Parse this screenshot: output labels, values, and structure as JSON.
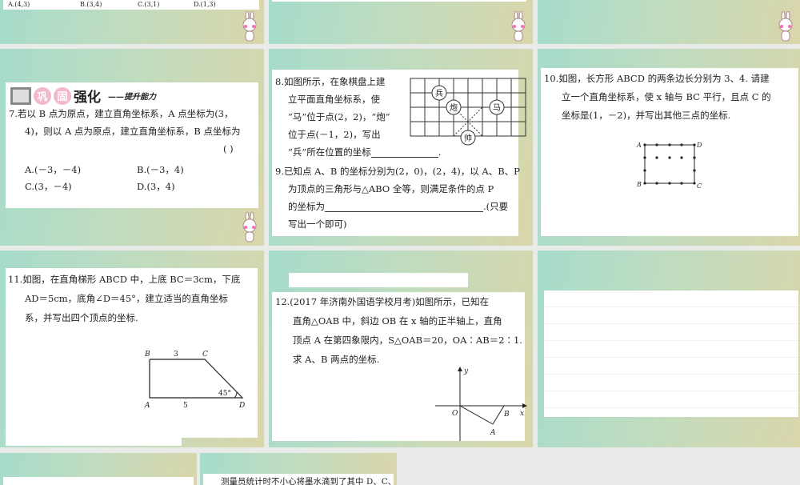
{
  "slide1_top": {
    "options": [
      "A.(4,3)",
      "B.(3,4)",
      "C.(3,1)",
      "D.(1,3)"
    ]
  },
  "q7": {
    "header_badges": [
      "巩",
      "固"
    ],
    "header_title": "强化",
    "header_sub": "——提升能力",
    "line1": "7.若以 B 点为原点，建立直角坐标系，A 点坐标为(3，",
    "line2": "4)，则以 A 点为原点，建立直角坐标系，B 点坐标为",
    "paren": "(      )",
    "options": [
      "A.(－3，－4)",
      "B.(－3，4)",
      "C.(3，－4)",
      "D.(3，4)"
    ]
  },
  "q8": {
    "lines": [
      "8.如图所示，在象棋盘上建",
      "立平面直角坐标系，使",
      "“马”位于点(2，2)，“炮”",
      "位于点(－1，2)，写出",
      "“兵”所在位置的坐标"
    ],
    "end": ".",
    "pieces": [
      "兵",
      "炮",
      "马",
      "帅"
    ]
  },
  "q9": {
    "lines": [
      "9.已知点 A、B 的坐标分别为(2，0)，(2，4)，以 A、B、P",
      "为顶点的三角形与△ABO 全等，则满足条件的点 P",
      "的坐标为"
    ],
    "tail": ".(只要",
    "last": "写出一个即可)"
  },
  "q10": {
    "lines": [
      "10.如图，长方形 ABCD 的两条边长分别为 3、4. 请建",
      "立一个直角坐标系，使 x 轴与 BC 平行，且点 C 的",
      "坐标是(1，－2)，并写出其他三点的坐标."
    ],
    "labels": [
      "A",
      "D",
      "B",
      "C"
    ]
  },
  "q11": {
    "lines": [
      "11.如图，在直角梯形 ABCD 中，上底 BC＝3cm，下底",
      "AD＝5cm，底角∠D＝45°，建立适当的直角坐标",
      "系，并写出四个顶点的坐标."
    ],
    "labels": {
      "B": "B",
      "C": "C",
      "A": "A",
      "D": "D",
      "top": "3",
      "bottom": "5",
      "angle": "45°"
    }
  },
  "q12": {
    "lines": [
      "12.(2017 年济南外国语学校月考)如图所示，已知在",
      "直角△OAB 中，斜边 OB 在 x 轴的正半轴上，直角",
      "顶点 A 在第四象限内，S△OAB＝20，OA∶AB＝2∶1.",
      "求 A、B 两点的坐标."
    ],
    "labels": {
      "y": "y",
      "x": "x",
      "O": "O",
      "A": "A",
      "B": "B"
    }
  },
  "bottom": {
    "text": "测量员统计时不小心将墨水滴到了其中 D、C、B"
  }
}
